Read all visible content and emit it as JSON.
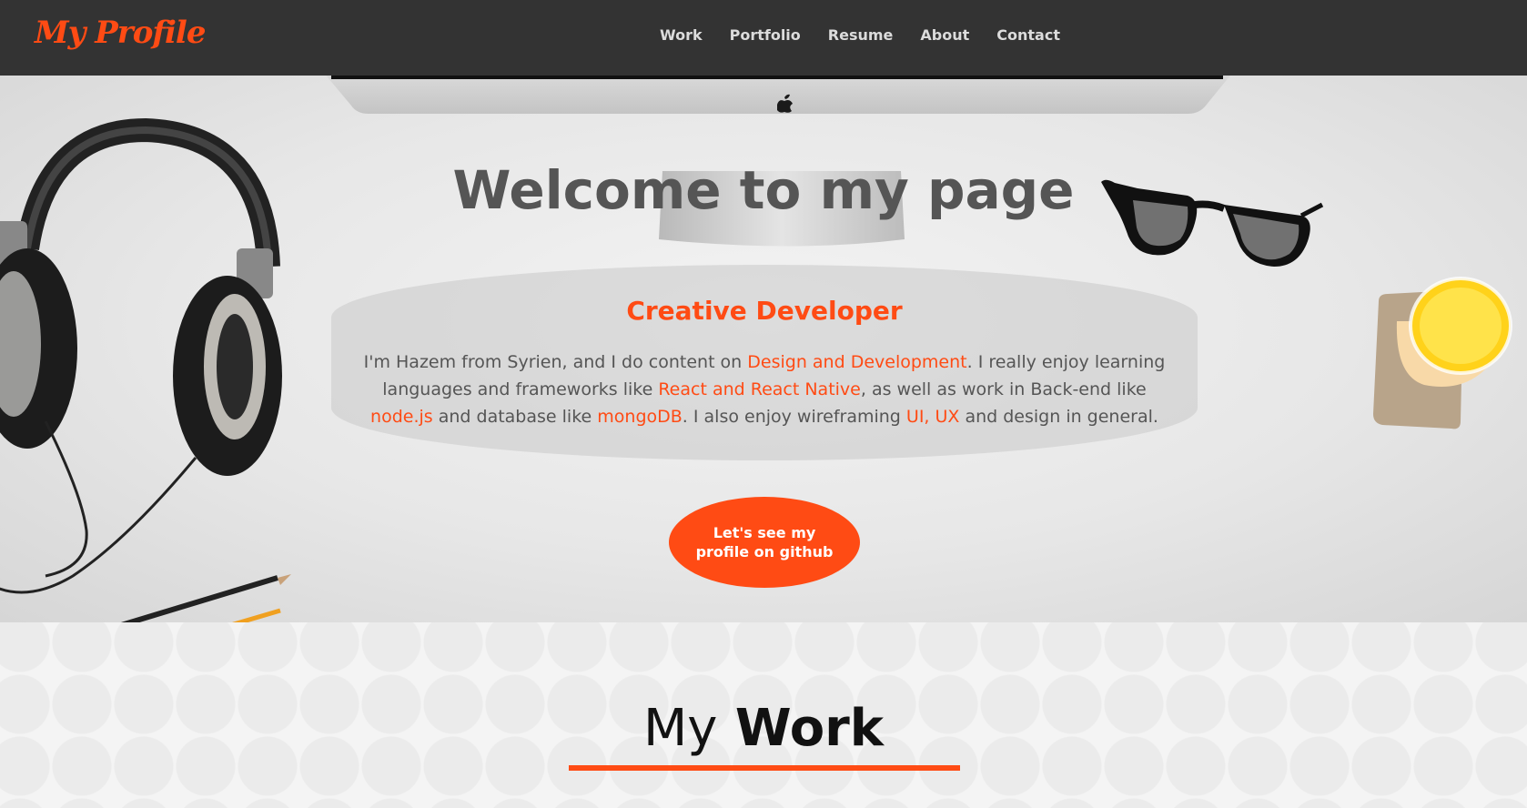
{
  "nav": {
    "logo": "My Profile",
    "links": [
      "Work",
      "Portfolio",
      "Resume",
      "About",
      "Contact"
    ]
  },
  "hero": {
    "title": "Welcome to my page",
    "card": {
      "heading": "Creative Developer",
      "text": {
        "p1": "I'm Hazem from Syrien, and I do content on ",
        "h1": "Design and Development",
        "p2": ". I really enjoy learning languages and frameworks like ",
        "h2": "React and React Native",
        "p3": ", as well as work in Back-end like ",
        "h3": "node.js",
        "p4": " and database like ",
        "h4": "mongoDB",
        "p5": ". I also enjoy wireframing ",
        "h5": "UI, UX",
        "p6": " and design in general."
      }
    },
    "cta_label": "Let's see my profile on github"
  },
  "work": {
    "title_light": "My",
    "title_bold": "Work"
  },
  "colors": {
    "accent": "#ff4b14",
    "navbar": "#333333",
    "text": "#555555"
  },
  "icons": [
    "headphones-icon",
    "glasses-icon",
    "juice-glass-icon",
    "pencil-icon",
    "apple-logo-icon",
    "monitor-icon"
  ]
}
